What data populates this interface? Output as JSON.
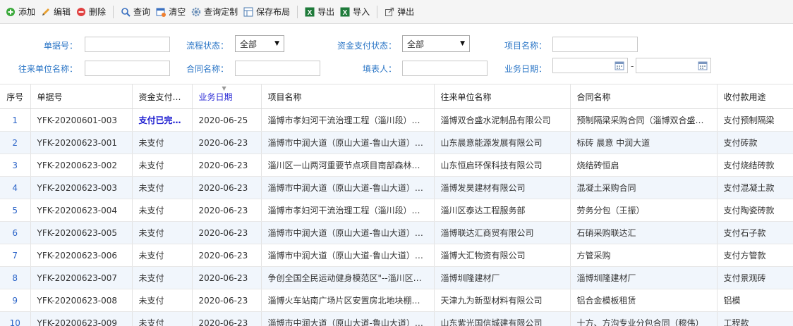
{
  "toolbar": {
    "buttons": [
      {
        "label": "添加",
        "icon": "add-icon"
      },
      {
        "label": "编辑",
        "icon": "pencil-icon"
      },
      {
        "label": "删除",
        "icon": "delete-icon"
      },
      {
        "label": "查询",
        "icon": "search-icon"
      },
      {
        "label": "清空",
        "icon": "clear-icon"
      },
      {
        "label": "查询定制",
        "icon": "gear-icon"
      },
      {
        "label": "保存布局",
        "icon": "layout-icon"
      },
      {
        "label": "导出",
        "icon": "excel-export-icon"
      },
      {
        "label": "导入",
        "icon": "excel-import-icon"
      },
      {
        "label": "弹出",
        "icon": "popout-icon"
      }
    ]
  },
  "filters": {
    "doc_no_label": "单据号：",
    "flow_status_label": "流程状态：",
    "flow_status_value": "全部",
    "fund_status_label": "资金支付状态：",
    "fund_status_value": "全部",
    "project_name_label": "项目名称：",
    "partner_label": "往来单位名称：",
    "contract_label": "合同名称：",
    "filler_label": "填表人：",
    "biz_date_label": "业务日期：",
    "date_separator": "-"
  },
  "table": {
    "headers": [
      "序号",
      "单据号",
      "资金支付…",
      "业务日期",
      "项目名称",
      "往来单位名称",
      "合同名称",
      "收付款用途"
    ],
    "rows": [
      [
        "1",
        "YFK-20200601-003",
        "支付已完…",
        "2020-06-25",
        "淄博市孝妇河干流治理工程（淄川段）…",
        "淄博双合盛水泥制品有限公司",
        "预制隔梁采购合同（淄博双合盛…",
        "支付预制隔梁"
      ],
      [
        "2",
        "YFK-20200623-001",
        "未支付",
        "2020-06-23",
        "淄博市中润大道（原山大道-鲁山大道）…",
        "山东晨意能源发展有限公司",
        "标砖 晨意 中润大道",
        "支付砖款"
      ],
      [
        "3",
        "YFK-20200623-002",
        "未支付",
        "2020-06-23",
        "淄川区一山两河重要节点项目南部森林…",
        "山东恒启环保科技有限公司",
        "烧结砖恒启",
        "支付烧结砖款"
      ],
      [
        "4",
        "YFK-20200623-003",
        "未支付",
        "2020-06-23",
        "淄博市中润大道（原山大道-鲁山大道）…",
        "淄博发昊建材有限公司",
        "混凝土采购合同",
        "支付混凝土款"
      ],
      [
        "5",
        "YFK-20200623-004",
        "未支付",
        "2020-06-23",
        "淄博市孝妇河干流治理工程（淄川段）…",
        "淄川区泰达工程服务部",
        "劳务分包（王振）",
        "支付陶瓷砖款"
      ],
      [
        "6",
        "YFK-20200623-005",
        "未支付",
        "2020-06-23",
        "淄博市中润大道（原山大道-鲁山大道）…",
        "淄博联达汇商贸有限公司",
        "石硝采购联达汇",
        "支付石子款"
      ],
      [
        "7",
        "YFK-20200623-006",
        "未支付",
        "2020-06-23",
        "淄博市中润大道（原山大道-鲁山大道）…",
        "淄博大汇物资有限公司",
        "方管采购",
        "支付方管款"
      ],
      [
        "8",
        "YFK-20200623-007",
        "未支付",
        "2020-06-23",
        "争创全国全民运动健身模范区\"--淄川区…",
        "淄博圳隆建材厂",
        "淄博圳隆建材厂",
        "支付景观砖"
      ],
      [
        "9",
        "YFK-20200623-008",
        "未支付",
        "2020-06-23",
        "淄博火车站南广场片区安置房北地块棚…",
        "天津九为新型材料有限公司",
        "铝合金模板租赁",
        "铝模"
      ],
      [
        "10",
        "YFK-20200623-009",
        "未支付",
        "2020-06-23",
        "淄博市中润大道（原山大道-鲁山大道）…",
        "山东紫光国信城建有限公司",
        "十方、方沟专业分包合同（穆伟）",
        "工程款"
      ]
    ]
  }
}
